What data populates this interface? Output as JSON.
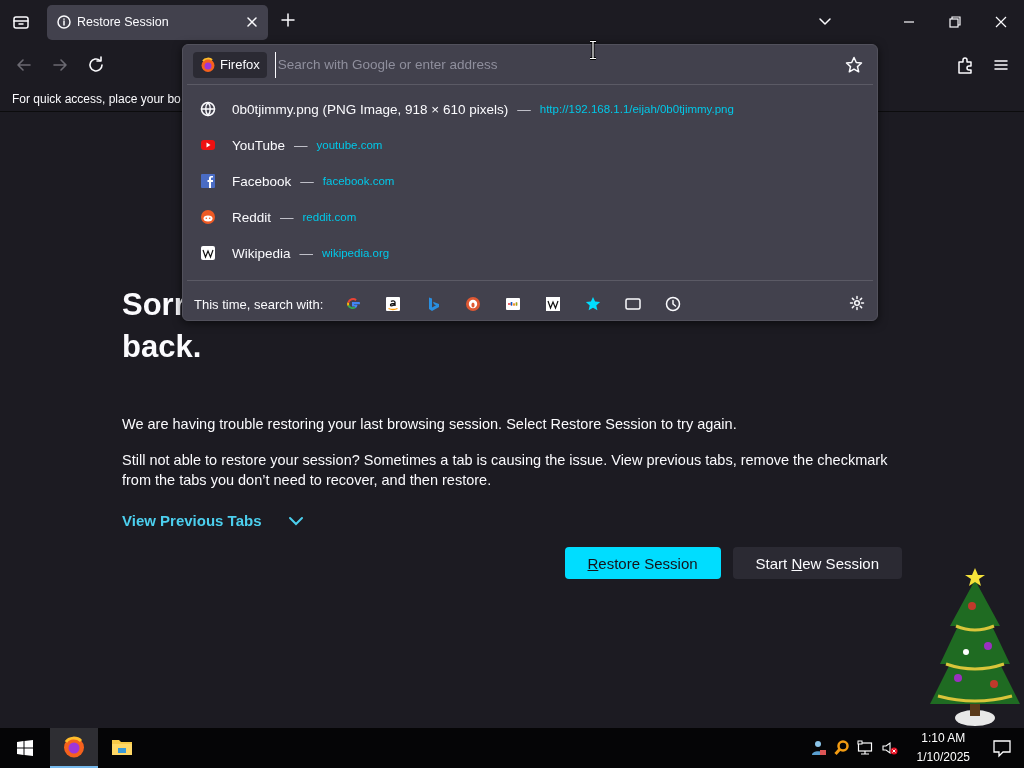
{
  "window": {
    "controls": [
      {
        "kind": "list-tabs"
      },
      {
        "kind": "minimize"
      },
      {
        "kind": "maximize"
      },
      {
        "kind": "close"
      }
    ]
  },
  "tabs": [
    {
      "title": "Restore Session",
      "selected": true
    }
  ],
  "nav_buttons": [
    {
      "kind": "back",
      "disabled": true
    },
    {
      "kind": "forward",
      "disabled": true
    },
    {
      "kind": "reload",
      "disabled": false
    }
  ],
  "bookmarks_bar": {
    "text": "For quick access, place your bo"
  },
  "urlbar": {
    "identity": "Firefox",
    "placeholder": "Search with Google or enter address",
    "results": [
      {
        "kind": "page",
        "title": "0b0tjimmy.png (PNG Image, 918 × 610 pixels)",
        "dash": "—",
        "url": "http://192.168.1.1/eijah/0b0tjimmy.png"
      },
      {
        "kind": "youtube",
        "title": "YouTube",
        "dash": "—",
        "url": "youtube.com"
      },
      {
        "kind": "facebook",
        "title": "Facebook",
        "dash": "—",
        "url": "facebook.com"
      },
      {
        "kind": "reddit",
        "title": "Reddit",
        "dash": "—",
        "url": "reddit.com"
      },
      {
        "kind": "wikipedia",
        "title": "Wikipedia",
        "dash": "—",
        "url": "wikipedia.org"
      }
    ],
    "search_label": "This time, search with:",
    "engines": [
      {
        "kind": "google"
      },
      {
        "kind": "amazon"
      },
      {
        "kind": "bing"
      },
      {
        "kind": "duckduckgo"
      },
      {
        "kind": "ebay"
      },
      {
        "kind": "wikipedia"
      },
      {
        "kind": "bookmarks"
      },
      {
        "kind": "tabs"
      },
      {
        "kind": "history"
      }
    ]
  },
  "content": {
    "heading_line_1": "Sorr",
    "heading_line_2": "back.",
    "paragraphs": [
      "We are having trouble restoring your last browsing session. Select Restore Session to try again.",
      "Still not able to restore your session? Sometimes a tab is causing the issue. View previous tabs, remove the checkmark from the tabs you don’t need to recover, and then restore."
    ],
    "view_tabs": {
      "label": "View Previous Tabs",
      "expanded": false
    },
    "buttons": [
      {
        "kind": "primary",
        "access_key": "R",
        "rest": "estore Session"
      },
      {
        "kind": "secondary",
        "before": "Start ",
        "access_key": "N",
        "rest": "ew Session"
      }
    ]
  },
  "taskbar": {
    "apps": [
      {
        "kind": "firefox",
        "active": true
      },
      {
        "kind": "explorer",
        "active": false
      }
    ],
    "tray": [
      {
        "kind": "people"
      },
      {
        "kind": "magnifier"
      },
      {
        "kind": "network"
      },
      {
        "kind": "volume-muted"
      }
    ],
    "time": "1:10 AM",
    "date": "1/10/2025"
  }
}
